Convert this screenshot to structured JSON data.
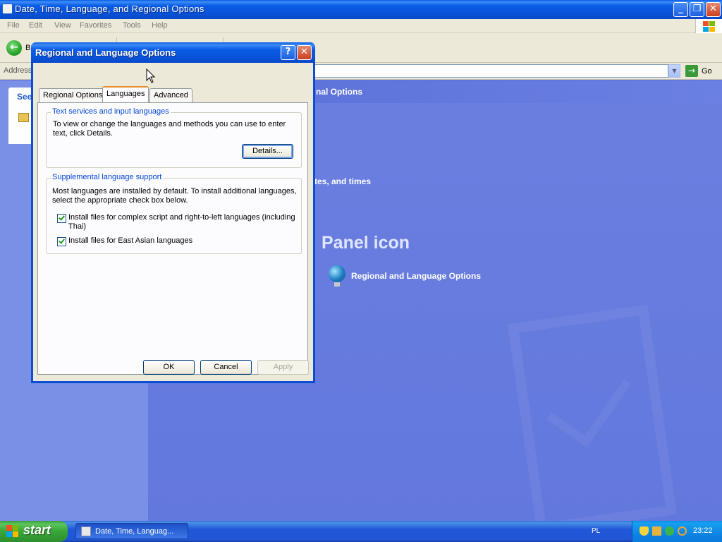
{
  "window": {
    "title": "Date, Time, Language, and Regional Options",
    "menu": [
      "File",
      "Edit",
      "View",
      "Favorites",
      "Tools",
      "Help"
    ],
    "back_label": "B",
    "address_label": "Address",
    "go_label": "Go"
  },
  "left_pane": {
    "task_heading": "See"
  },
  "background": {
    "header_text": "nal Options",
    "subtitle": "tes, and times",
    "heading": "Panel icon",
    "link": "Regional and Language Options"
  },
  "dialog": {
    "title": "Regional and Language Options",
    "help_button": "?",
    "close_button": "✕",
    "tabs": [
      {
        "label": "Regional Options",
        "active": false
      },
      {
        "label": "Languages",
        "active": true
      },
      {
        "label": "Advanced",
        "active": false
      }
    ],
    "text_services": {
      "legend": "Text services and input languages",
      "line1": "To view or change the languages and methods you can use to enter",
      "line2": "text, click Details.",
      "details_button": "Details..."
    },
    "supplemental": {
      "legend": "Supplemental language support",
      "line1": "Most languages are installed by default. To install additional languages,",
      "line2": "select the appropriate check box below.",
      "checkbox1_line1": "Install files for complex script and right-to-left languages (including",
      "checkbox1_line2": "Thai)",
      "checkbox1_checked": true,
      "checkbox2": "Install files for East Asian languages",
      "checkbox2_checked": true
    },
    "buttons": {
      "ok": "OK",
      "cancel": "Cancel",
      "apply": "Apply"
    }
  },
  "taskbar": {
    "start": "start",
    "task_item": "Date, Time, Languag...",
    "language": "PL",
    "clock": "23:22"
  }
}
